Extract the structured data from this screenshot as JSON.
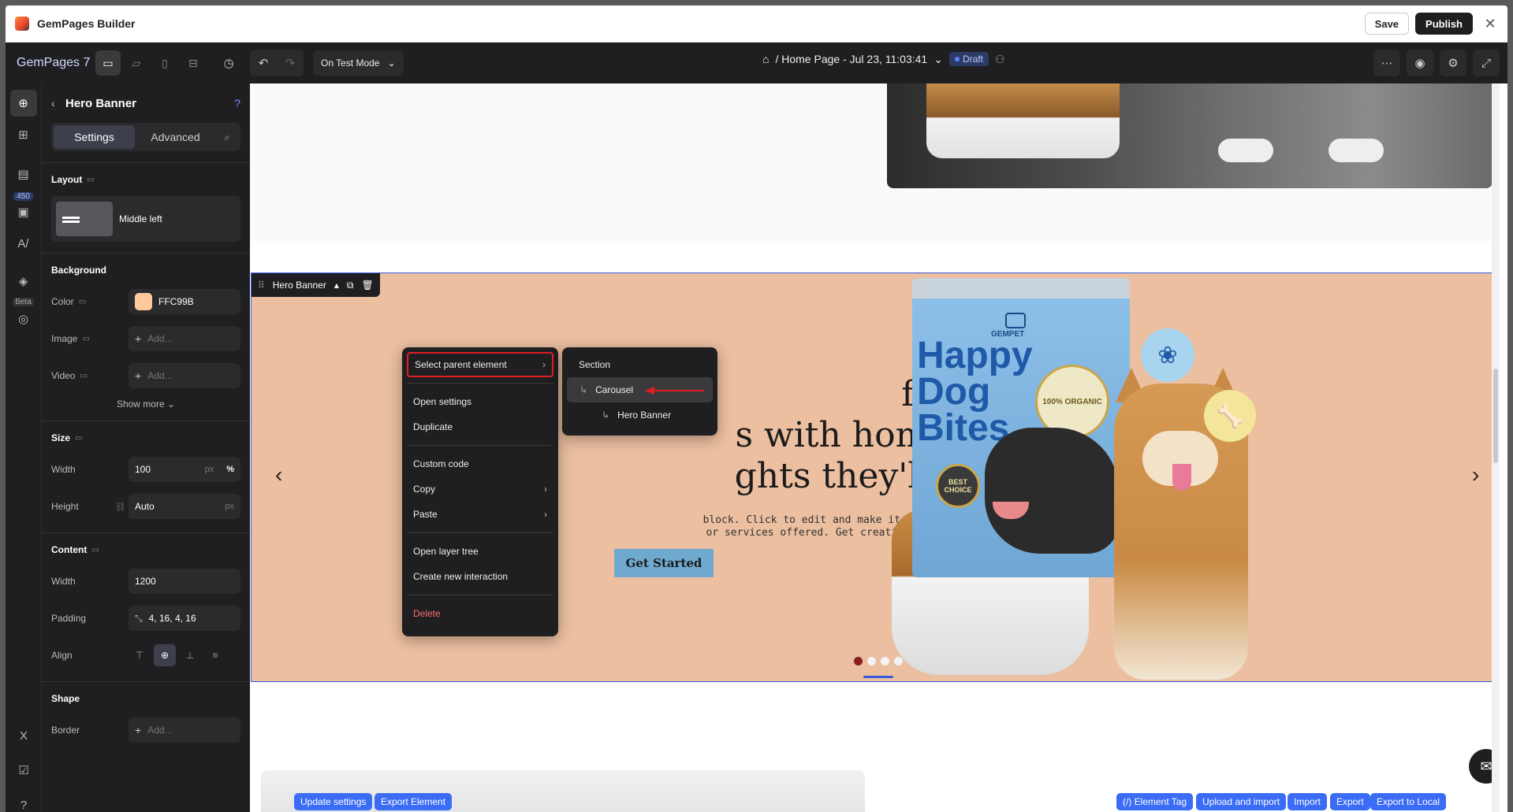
{
  "titlebar": {
    "app_title": "GemPages Builder",
    "save": "Save",
    "publish": "Publish"
  },
  "toolbar": {
    "brand": "GemPages 7",
    "mode": "On Test Mode",
    "page": "/ Home Page - Jul 23, 11:03:41",
    "status": "Draft"
  },
  "rail": {
    "badge": "450",
    "beta": "Beta"
  },
  "panel": {
    "title": "Hero Banner",
    "tab_settings": "Settings",
    "tab_advanced": "Advanced",
    "layout": {
      "title": "Layout",
      "value": "Middle left"
    },
    "background": {
      "title": "Background",
      "color_label": "Color",
      "color_value": "FFC99B",
      "color_hex": "#FFC99B",
      "image_label": "Image",
      "image_value": "Add...",
      "video_label": "Video",
      "video_value": "Add...",
      "show_more": "Show more"
    },
    "size": {
      "title": "Size",
      "width_label": "Width",
      "width_value": "100",
      "width_unit_px": "px",
      "width_unit_pct": "%",
      "height_label": "Height",
      "height_value": "Auto",
      "height_unit": "px"
    },
    "content": {
      "title": "Content",
      "width_label": "Width",
      "width_value": "1200",
      "padding_label": "Padding",
      "padding_value": "4, 16, 4, 16",
      "align_label": "Align"
    },
    "shape": {
      "title": "Shape",
      "border_label": "Border",
      "border_value": "Add..."
    }
  },
  "hero": {
    "tag": "Hero Banner",
    "headline_line1": "furry",
    "headline_line2": "s with homemade",
    "headline_line3": "ghts they'll crave",
    "body_line1": "block. Click to edit and make it your own. Share your",
    "body_line2": "or services offered. Get creative and make it yours!",
    "cta": "Get Started",
    "product": {
      "brand": "GEMPET",
      "name_line1": "Happy",
      "name_line2": "Dog",
      "name_line3": "Bites",
      "seal": "100% ORGANIC",
      "medal": "BEST CHOICE"
    }
  },
  "context_menu": {
    "select_parent": "Select parent element",
    "open_settings": "Open settings",
    "duplicate": "Duplicate",
    "custom_code": "Custom code",
    "copy": "Copy",
    "paste": "Paste",
    "open_layer_tree": "Open layer tree",
    "create_interaction": "Create new interaction",
    "delete": "Delete"
  },
  "submenu": {
    "section": "Section",
    "carousel": "Carousel",
    "hero_banner": "Hero Banner"
  },
  "bottom_chips": {
    "update_settings": "Update settings",
    "export_element": "Export Element",
    "element_tag": "(/) Element Tag",
    "upload_import": "Upload and import",
    "import": "Import",
    "export": "Export",
    "export_local": "Export to Local"
  }
}
